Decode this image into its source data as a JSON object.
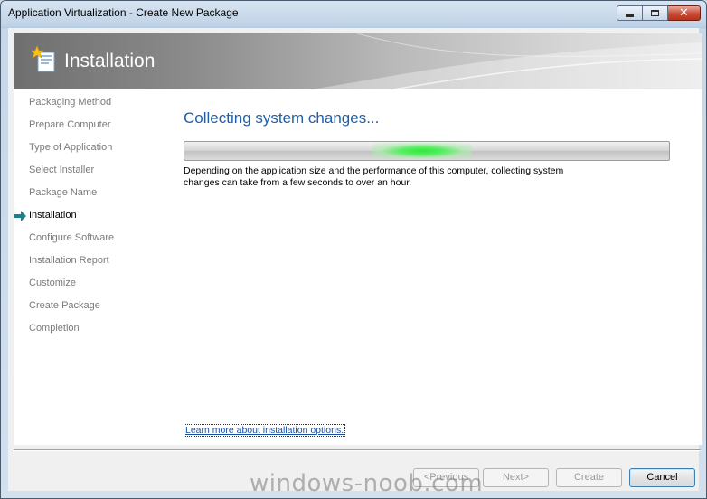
{
  "window": {
    "title": "Application Virtualization - Create New Package",
    "close_glyph": "✕"
  },
  "banner": {
    "title": "Installation",
    "icon": "package-wizard-icon"
  },
  "steps": [
    {
      "label": "Packaging Method",
      "active": false
    },
    {
      "label": "Prepare Computer",
      "active": false
    },
    {
      "label": "Type of Application",
      "active": false
    },
    {
      "label": "Select Installer",
      "active": false
    },
    {
      "label": "Package Name",
      "active": false
    },
    {
      "label": "Installation",
      "active": true
    },
    {
      "label": "Configure Software",
      "active": false
    },
    {
      "label": "Installation Report",
      "active": false
    },
    {
      "label": "Customize",
      "active": false
    },
    {
      "label": "Create Package",
      "active": false
    },
    {
      "label": "Completion",
      "active": false
    }
  ],
  "main": {
    "heading": "Collecting system changes...",
    "progress_state": "marquee",
    "description": "Depending on the application size and the performance of this computer, collecting system changes can take from a few seconds to over an hour.",
    "learn_more": "Learn more about installation options."
  },
  "buttons": {
    "previous": "<Previous",
    "next": "Next>",
    "create": "Create",
    "cancel": "Cancel"
  },
  "watermark": "windows-noob.com",
  "colors": {
    "heading": "#1f5fa8",
    "progress_glow": "#2ee83a",
    "active_arrow": "#1e7f8c"
  }
}
